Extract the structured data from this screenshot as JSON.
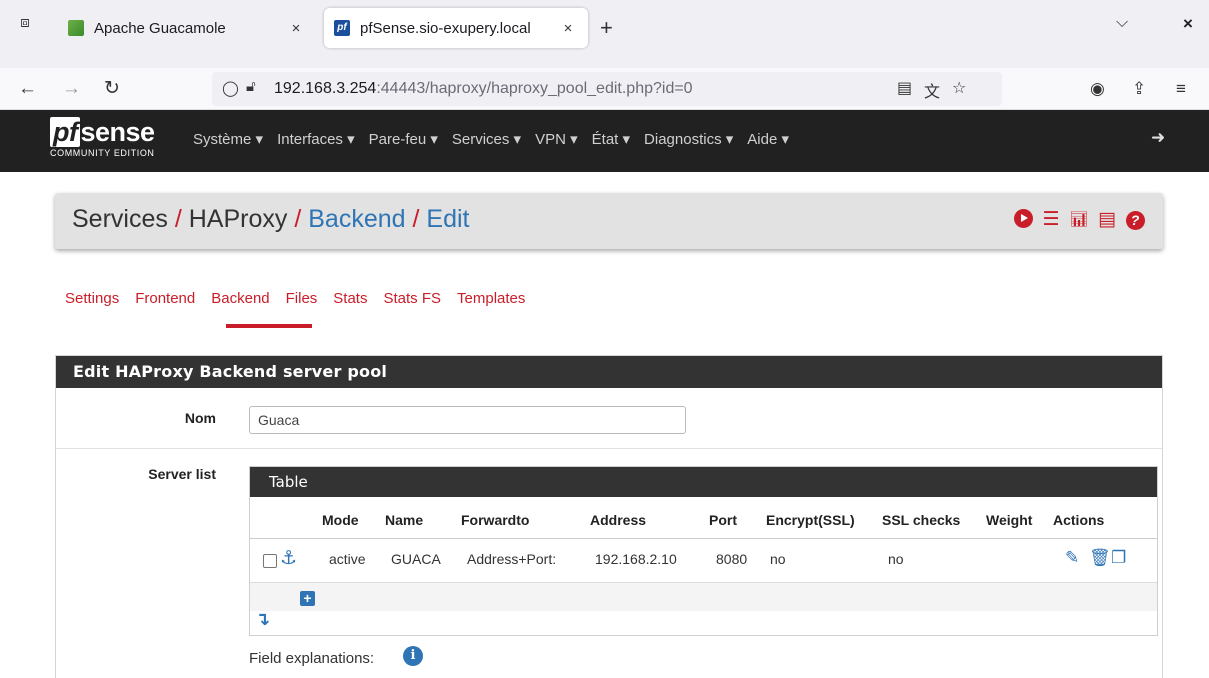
{
  "browser": {
    "tabs": [
      {
        "title": "Apache Guacamole",
        "active": false
      },
      {
        "title": "pfSense.sio-exupery.local",
        "active": true
      }
    ],
    "close_glyph": "×",
    "newtab_glyph": "+",
    "url_host": "192.168.3.254",
    "url_rest": ":44443/haproxy/haproxy_pool_edit.php?id=0"
  },
  "pfsense": {
    "logo_main": "sense",
    "logo_pf": "pf",
    "logo_sub": "COMMUNITY EDITION",
    "menu": [
      "Système ▾",
      "Interfaces ▾",
      "Pare-feu ▾",
      "Services ▾",
      "VPN ▾",
      "État ▾",
      "Diagnostics ▾",
      "Aide ▾"
    ]
  },
  "breadcrumb": {
    "items": [
      "Services",
      "HAProxy",
      "Backend",
      "Edit"
    ],
    "separator": "/"
  },
  "subtabs": [
    "Settings",
    "Frontend",
    "Backend",
    "Files",
    "Stats",
    "Stats FS",
    "Templates"
  ],
  "active_subtab": "Backend",
  "panel": {
    "title": "Edit HAProxy Backend server pool",
    "nom_label": "Nom",
    "nom_value": "Guaca",
    "server_list_label": "Server list",
    "table_title": "Table",
    "columns": [
      "Mode",
      "Name",
      "Forwardto",
      "Address",
      "Port",
      "Encrypt(SSL)",
      "SSL checks",
      "Weight",
      "Actions"
    ],
    "rows": [
      {
        "mode": "active",
        "name": "GUACA",
        "forwardto": "Address+Port:",
        "address": "192.168.2.10",
        "port": "8080",
        "encrypt": "no",
        "ssl_checks": "no",
        "weight": ""
      }
    ],
    "field_explanations": "Field explanations:"
  },
  "icons": {
    "accent_red": "#c91e29",
    "accent_blue": "#2f74b5"
  }
}
